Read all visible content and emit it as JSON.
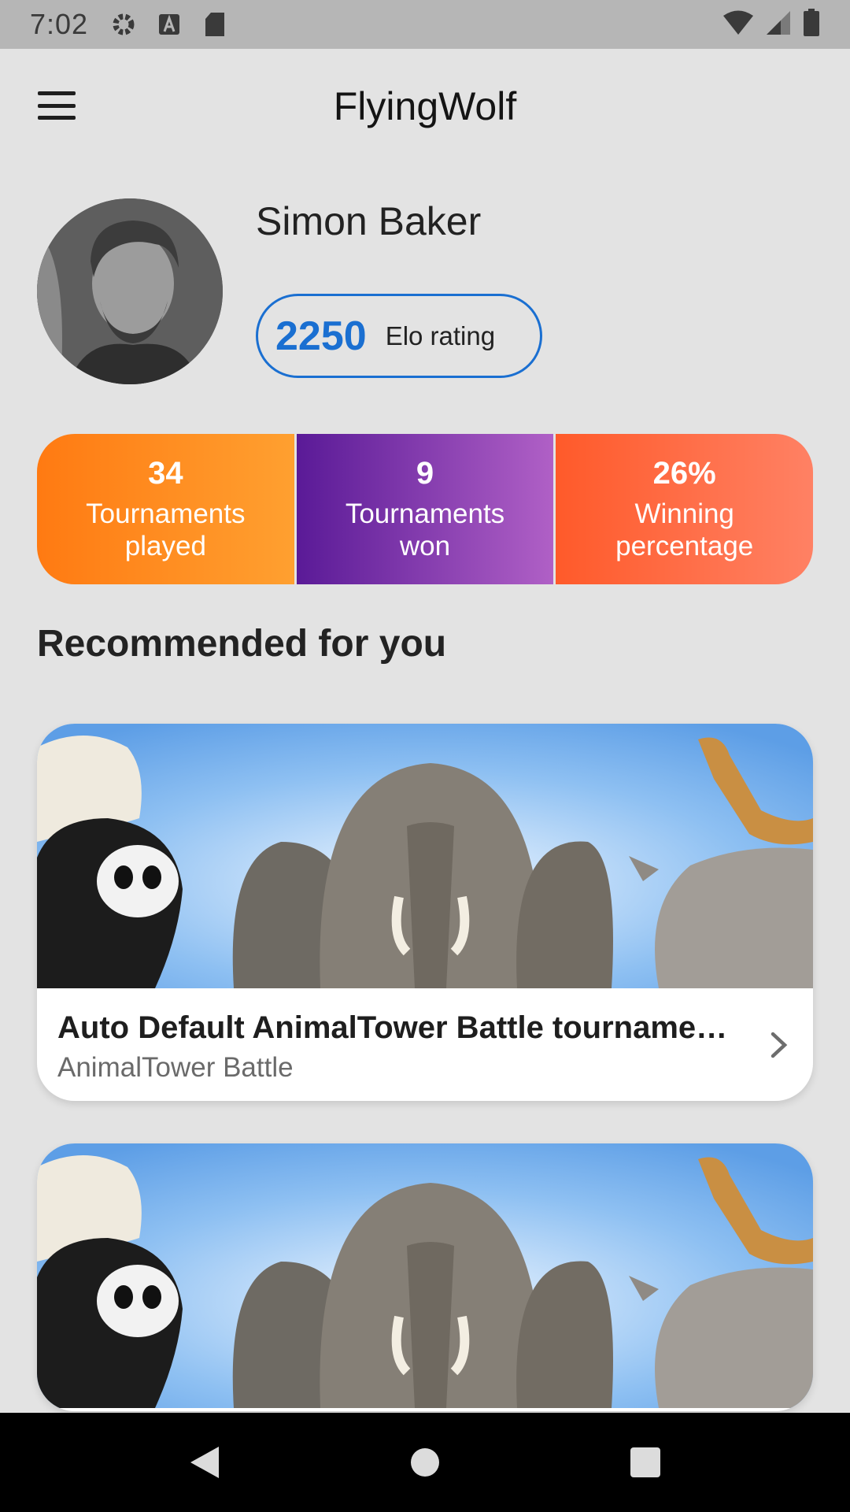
{
  "status_bar": {
    "time": "7:02"
  },
  "app_bar": {
    "title": "FlyingWolf"
  },
  "profile": {
    "name": "Simon Baker",
    "elo_value": "2250",
    "elo_label": "Elo rating"
  },
  "stats": [
    {
      "value": "34",
      "label_line1": "Tournaments",
      "label_line2": "played"
    },
    {
      "value": "9",
      "label_line1": "Tournaments",
      "label_line2": "won"
    },
    {
      "value": "26%",
      "label_line1": "Winning",
      "label_line2": "percentage"
    }
  ],
  "recommended": {
    "heading": "Recommended for you",
    "cards": [
      {
        "title": "Auto Default AnimalTower Battle tourname…",
        "subtitle": "AnimalTower Battle"
      },
      {
        "title": "",
        "subtitle": ""
      }
    ]
  },
  "colors": {
    "accent": "#1a6fd1",
    "stat_played": "#ff8a1f",
    "stat_won": "#7b2fb0",
    "stat_winning": "#ff6a44"
  }
}
